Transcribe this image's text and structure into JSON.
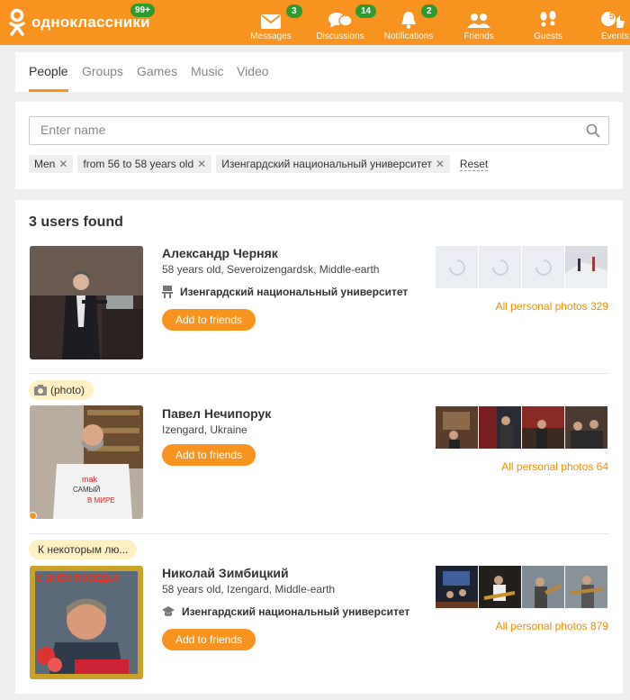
{
  "header": {
    "logo_text": "одноклассники",
    "logo_badge": "99+",
    "nav": [
      {
        "label": "Messages",
        "badge": "3",
        "icon": "envelope-icon"
      },
      {
        "label": "Discussions",
        "badge": "14",
        "icon": "chat-bubbles-icon"
      },
      {
        "label": "Notifications",
        "badge": "2",
        "icon": "bell-icon"
      },
      {
        "label": "Friends",
        "badge": "",
        "icon": "friends-icon"
      },
      {
        "label": "Guests",
        "badge": "",
        "icon": "footprints-icon"
      },
      {
        "label": "Events",
        "badge": "5",
        "icon": "thumbs-up-icon"
      }
    ]
  },
  "tabs": [
    "People",
    "Groups",
    "Games",
    "Music",
    "Video"
  ],
  "active_tab": "People",
  "search": {
    "placeholder": "Enter name",
    "value": "",
    "filters": [
      "Men",
      "from 56 to 58 years old",
      "Изенгардский национальный университет"
    ],
    "reset_label": "Reset"
  },
  "results": {
    "title": "3 users found",
    "users": [
      {
        "status": "",
        "name": "Александр Черняк",
        "info": "58 years old, Severoizengardsk, Middle-earth",
        "university": "Изенгардский национальный университет",
        "button": "Add to friends",
        "photos_link": "All personal photos 329",
        "online": false
      },
      {
        "status": "(photo)",
        "name": "Павел Нечипорук",
        "info": "Izengard, Ukraine",
        "university": "",
        "button": "Add to friends",
        "photos_link": "All personal photos 64",
        "online": true
      },
      {
        "status": "К некоторым лю...",
        "name": "Николай Зимбицкий",
        "info": "58 years old, Izengard, Middle-earth",
        "university": "Изенгардский национальный университет",
        "button": "Add to friends",
        "photos_link": "All personal photos 879",
        "online": false
      }
    ]
  },
  "colors": {
    "brand": "#f7931e",
    "badge": "#2e9b2e",
    "status_pill": "#fdf0c3"
  }
}
